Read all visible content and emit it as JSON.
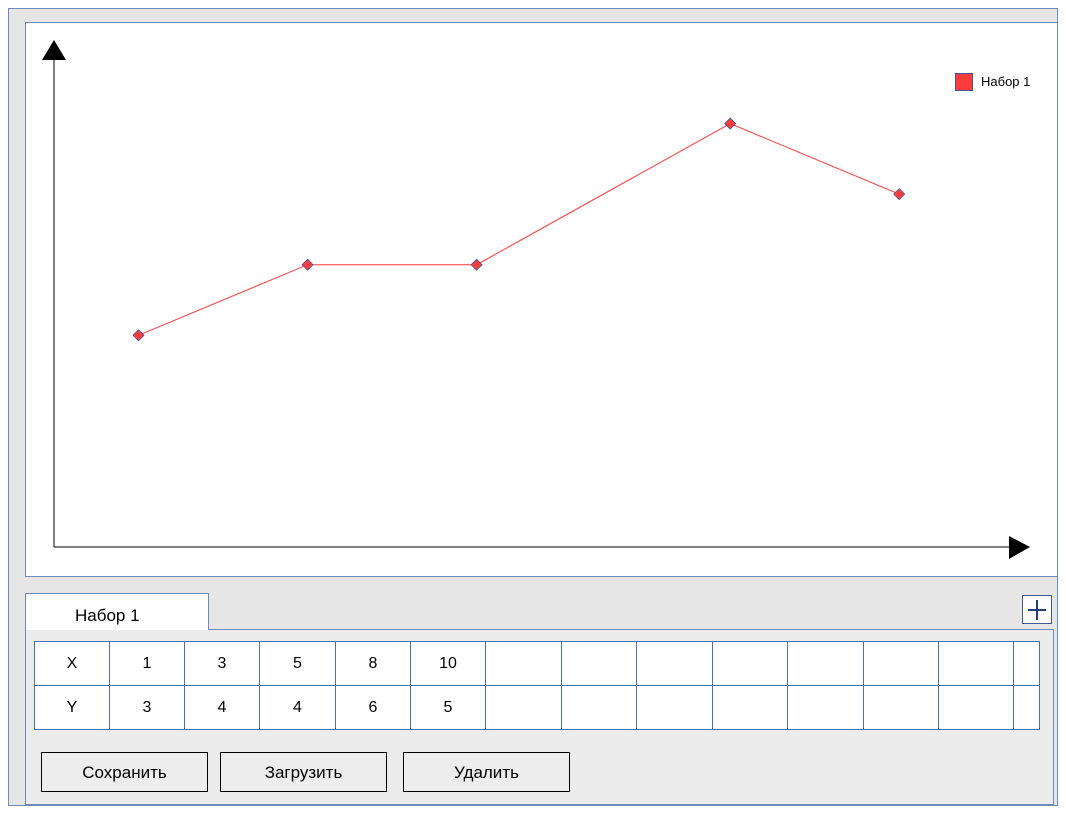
{
  "chart_data": {
    "type": "line",
    "x": [
      1,
      3,
      5,
      8,
      10
    ],
    "series": [
      {
        "name": "Набор 1",
        "values": [
          3,
          4,
          4,
          6,
          5
        ],
        "color": "#ff3b3b"
      }
    ],
    "title": "",
    "xlabel": "",
    "ylabel": "",
    "xlim": [
      0,
      11.5
    ],
    "ylim": [
      0,
      7
    ],
    "grid": false,
    "legend_position": "top-right",
    "marker": "diamond",
    "axis_color": "#000000"
  },
  "tabs": [
    {
      "label": "Набор 1",
      "active": true
    }
  ],
  "add_tab_icon": "plus-icon",
  "table": {
    "row_headers": [
      "X",
      "Y"
    ],
    "rows": [
      [
        "1",
        "3",
        "5",
        "8",
        "10",
        "",
        "",
        "",
        "",
        "",
        "",
        "",
        ""
      ],
      [
        "3",
        "4",
        "4",
        "6",
        "5",
        "",
        "",
        "",
        "",
        "",
        "",
        "",
        ""
      ]
    ]
  },
  "buttons": {
    "save": "Сохранить",
    "load": "Загрузить",
    "delete": "Удалить"
  }
}
